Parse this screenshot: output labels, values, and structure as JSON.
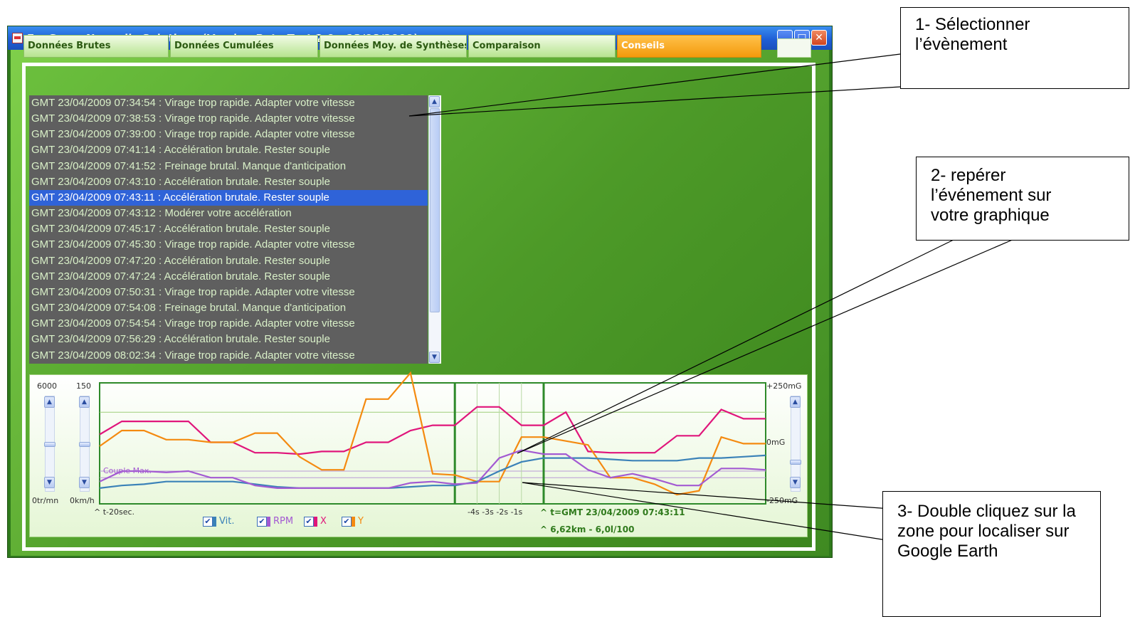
{
  "window": {
    "title": "EcoGyzer Nomadic Solutions (Version Beta Test 2.0 - 13/08/2009)",
    "controls": {
      "minimize": "minimize-button",
      "maximize": "maximize-button",
      "close": "close-button"
    }
  },
  "tabs": [
    {
      "label": "Données Brutes",
      "active": false
    },
    {
      "label": "Données Cumulées",
      "active": false
    },
    {
      "label": "Données Moy. de Synthèses",
      "active": false
    },
    {
      "label": "Comparaison",
      "active": false
    },
    {
      "label": "Conseils",
      "active": true
    }
  ],
  "events": [
    {
      "text": "GMT 23/04/2009 07:34:54 : Virage trop rapide. Adapter votre vitesse",
      "selected": false
    },
    {
      "text": "GMT 23/04/2009 07:38:53 : Virage trop rapide. Adapter votre vitesse",
      "selected": false
    },
    {
      "text": "GMT 23/04/2009 07:39:00 : Virage trop rapide. Adapter votre vitesse",
      "selected": false
    },
    {
      "text": "GMT 23/04/2009 07:41:14 : Accélération brutale. Rester souple",
      "selected": false
    },
    {
      "text": "GMT 23/04/2009 07:41:52 : Freinage brutal. Manque d'anticipation",
      "selected": false
    },
    {
      "text": "GMT 23/04/2009 07:43:10 : Accélération brutale. Rester souple",
      "selected": false
    },
    {
      "text": "GMT 23/04/2009 07:43:11 : Accélération brutale. Rester souple",
      "selected": true
    },
    {
      "text": "GMT 23/04/2009 07:43:12 : Modérer votre accélération",
      "selected": false
    },
    {
      "text": "GMT 23/04/2009 07:45:17 : Accélération brutale. Rester souple",
      "selected": false
    },
    {
      "text": "GMT 23/04/2009 07:45:30 : Virage trop rapide. Adapter votre vitesse",
      "selected": false
    },
    {
      "text": "GMT 23/04/2009 07:47:20 : Accélération brutale. Rester souple",
      "selected": false
    },
    {
      "text": "GMT 23/04/2009 07:47:24 : Accélération brutale. Rester souple",
      "selected": false
    },
    {
      "text": "GMT 23/04/2009 07:50:31 : Virage trop rapide. Adapter votre vitesse",
      "selected": false
    },
    {
      "text": "GMT 23/04/2009 07:54:08 : Freinage brutal. Manque d'anticipation",
      "selected": false
    },
    {
      "text": "GMT 23/04/2009 07:54:54 : Virage trop rapide. Adapter votre vitesse",
      "selected": false
    },
    {
      "text": "GMT 23/04/2009 07:56:29 : Accélération brutale. Rester souple",
      "selected": false
    },
    {
      "text": "GMT 23/04/2009 08:02:34 : Virage trop rapide. Adapter votre vitesse",
      "selected": false
    }
  ],
  "graph": {
    "rpm_max": "6000",
    "speed_max": "150",
    "rpm_min": "0tr/mn",
    "speed_min": "0km/h",
    "accel_max": "+250mG",
    "accel_mid": "0mG",
    "accel_min": "-250mG",
    "couple_label": "Couple Max.",
    "t_start": "^ t-20sec.",
    "t_ticks": "-4s  -3s  -2s  -1s",
    "t_event": "^ t=GMT 23/04/2009 07:43:11",
    "t_info": "^ 6,62km - 6,0l/100",
    "legend": [
      {
        "label": "Vit.",
        "color": "#3b82b8",
        "checked": true
      },
      {
        "label": "RPM",
        "color": "#a35ad2",
        "checked": true
      },
      {
        "label": "X",
        "color": "#e0157b",
        "checked": true
      },
      {
        "label": "Y",
        "color": "#f48a10",
        "checked": true
      }
    ]
  },
  "chart_data": {
    "type": "line",
    "x": [
      -20,
      -19,
      -18,
      -17,
      -16,
      -15,
      -14,
      -13,
      -12,
      -11,
      -10,
      -9,
      -8,
      -7,
      -6,
      -5,
      -4,
      -3,
      -2,
      -1,
      0,
      1,
      2,
      3,
      4,
      5,
      6,
      7,
      8,
      9,
      10
    ],
    "series": [
      {
        "name": "X",
        "color": "#e0157b",
        "values": [
          0.53,
          0.63,
          0.63,
          0.63,
          0.63,
          0.47,
          0.47,
          0.39,
          0.39,
          0.38,
          0.4,
          0.4,
          0.47,
          0.47,
          0.56,
          0.6,
          0.6,
          0.74,
          0.74,
          0.6,
          0.6,
          0.7,
          0.4,
          0.39,
          0.39,
          0.39,
          0.52,
          0.52,
          0.72,
          0.65,
          0.65
        ]
      },
      {
        "name": "Y",
        "color": "#f48a10",
        "values": [
          0.44,
          0.56,
          0.56,
          0.49,
          0.49,
          0.47,
          0.47,
          0.54,
          0.54,
          0.36,
          0.26,
          0.26,
          0.8,
          0.8,
          1.0,
          0.23,
          0.22,
          0.17,
          0.17,
          0.51,
          0.51,
          0.48,
          0.45,
          0.2,
          0.2,
          0.15,
          0.07,
          0.1,
          0.51,
          0.46,
          0.46
        ]
      },
      {
        "name": "Vit.",
        "color": "#3b82b8",
        "values": [
          0.12,
          0.14,
          0.15,
          0.17,
          0.17,
          0.17,
          0.17,
          0.15,
          0.13,
          0.12,
          0.12,
          0.12,
          0.12,
          0.12,
          0.13,
          0.14,
          0.14,
          0.17,
          0.25,
          0.32,
          0.35,
          0.35,
          0.35,
          0.34,
          0.33,
          0.33,
          0.33,
          0.35,
          0.35,
          0.36,
          0.37
        ]
      },
      {
        "name": "RPM",
        "color": "#a35ad2",
        "values": [
          0.17,
          0.25,
          0.25,
          0.24,
          0.25,
          0.2,
          0.2,
          0.14,
          0.12,
          0.12,
          0.12,
          0.12,
          0.12,
          0.12,
          0.16,
          0.17,
          0.15,
          0.16,
          0.35,
          0.41,
          0.38,
          0.38,
          0.26,
          0.2,
          0.23,
          0.19,
          0.14,
          0.14,
          0.27,
          0.27,
          0.26
        ]
      }
    ],
    "selected_time": "GMT 23/04/2009 07:43:11"
  },
  "annotations": [
    {
      "text": "1- Sélectionner l’évènement"
    },
    {
      "text": "2- repérer l’événement sur votre graphique"
    },
    {
      "text": "3- Double cliquez sur la zone pour localiser sur Google Earth"
    }
  ]
}
